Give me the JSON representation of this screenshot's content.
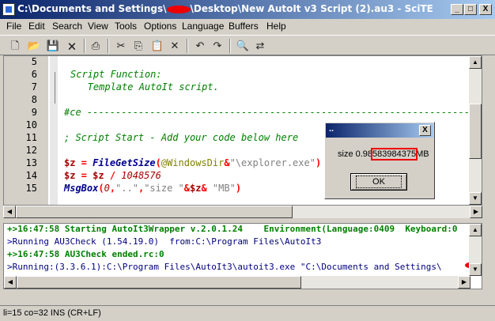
{
  "window": {
    "title_prefix": "C:\\Documents and Settings\\",
    "title_suffix": "\\Desktop\\New AutoIt v3 Script (2).au3 - SciTE",
    "min_label": "_",
    "max_label": "□",
    "close_label": "X"
  },
  "menu": [
    "File",
    "Edit",
    "Search",
    "View",
    "Tools",
    "Options",
    "Language",
    "Buffers",
    "Help"
  ],
  "toolbar": {
    "icons": [
      "new-file-icon",
      "open-folder-icon",
      "save-icon",
      "close-file-icon",
      "print-icon",
      "cut-icon",
      "copy-icon",
      "paste-icon",
      "delete-icon",
      "undo-icon",
      "redo-icon",
      "find-icon",
      "replace-icon"
    ]
  },
  "editor": {
    "line_numbers": [
      "5",
      "6",
      "7",
      "8",
      "9",
      "10",
      "11",
      "12",
      "13",
      "14",
      "15"
    ],
    "line6": "Script Function:",
    "line7": "   Template AutoIt script.",
    "line9": "#ce -------------------------------------------------------------------",
    "line11": "; Script Start - Add your code below here",
    "line13": {
      "a": "$z",
      "b": " = ",
      "c": "FileGetSize",
      "d": "(",
      "e": "@WindowsDir",
      "f": "&",
      "g": "\"\\explorer.exe\"",
      "h": ")"
    },
    "line14": {
      "a": "$z",
      "b": " = ",
      "c": "$z",
      "d": " / ",
      "e": "1048576"
    },
    "line15": {
      "a": "MsgBox",
      "b": "(",
      "c": "0",
      "d": ",",
      "e": "\"..\"",
      "f": ",",
      "g": "\"size \"",
      "h": "&",
      "i": "$z",
      "j": "&",
      "k": " \"MB\"",
      "l": ")"
    }
  },
  "dialog": {
    "title": "..",
    "close_label": "X",
    "msg_prefix": "size 0.98",
    "msg_highlight": "583984375",
    "msg_suffix": "MB",
    "ok_label": "OK"
  },
  "output": {
    "line1": "+>16:47:58 Starting AutoIt3Wrapper v.2.0.1.24    Environment(Language:0409  Keyboard:0",
    "line2": ">Running AU3Check (1.54.19.0)  from:C:\\Program Files\\AutoIt3",
    "line3": "+>16:47:58 AU3Check ended.rc:0",
    "line4": ">Running:(3.3.6.1):C:\\Program Files\\AutoIt3\\autoit3.exe \"C:\\Documents and Settings\\"
  },
  "status": {
    "text": "li=15 co=32 INS (CR+LF)"
  },
  "colors": {
    "titlebar_start": "#0a246a",
    "titlebar_end": "#a6caf0",
    "comment": "#008000",
    "variable": "#aa0000",
    "function": "#000090",
    "redaction": "#e00000"
  }
}
